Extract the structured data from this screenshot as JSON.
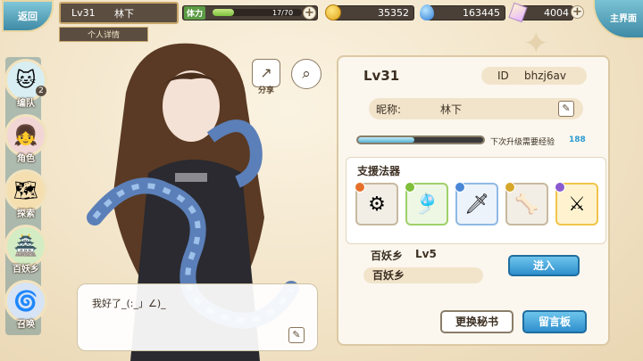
{
  "topbar": {
    "back_label": "返回",
    "level": "Lv31",
    "player_name": "林下",
    "tab_label": "个人详情",
    "stamina_label": "体力",
    "stamina_value": "17/70",
    "stamina_fraction": 0.243,
    "gold": "35352",
    "spirit": "163445",
    "crystal": "4004",
    "home_label": "主界面"
  },
  "nav": {
    "items": [
      {
        "label": "编队",
        "badge": "2",
        "icon": "cat-team-icon"
      },
      {
        "label": "角色",
        "icon": "character-icon"
      },
      {
        "label": "探索",
        "icon": "explore-icon"
      },
      {
        "label": "百妖乡",
        "icon": "village-icon"
      },
      {
        "label": "召唤",
        "icon": "summon-icon"
      }
    ]
  },
  "actions": {
    "share_label": "分享"
  },
  "speech": {
    "text": "我好了_(:_」∠)_"
  },
  "profile": {
    "level": "Lv31",
    "id_label": "ID",
    "id_value": "bhzj6av",
    "nickname_label": "昵称:",
    "nickname_value": "林下",
    "exp_fraction": 0.45,
    "exp_label": "下次升级需要经验",
    "exp_value": "188"
  },
  "support": {
    "title": "支援法器",
    "items": [
      {
        "icon": "spiked-bracelet-icon",
        "border": "#c7b9a0",
        "corner": "#e6702a",
        "bg": "#f2eee6"
      },
      {
        "icon": "green-scarf-icon",
        "border": "#9fd06a",
        "corner": "#7fbf3a",
        "bg": "#eef7e4"
      },
      {
        "icon": "blade-icon",
        "border": "#8fb9e4",
        "corner": "#4a86d6",
        "bg": "#edf3fb"
      },
      {
        "icon": "bone-bundle-icon",
        "border": "#c7b9a0",
        "corner": "#d6a72a",
        "bg": "#f2eee6"
      },
      {
        "icon": "spirit-sword-icon",
        "border": "#f1c54a",
        "corner": "#8a5ad0",
        "bg": "#fff3cf"
      }
    ]
  },
  "village": {
    "name": "百妖乡",
    "level": "Lv5",
    "pill": "百妖乡",
    "enter_label": "进入"
  },
  "buttons": {
    "change_secretary": "更换秘书",
    "message_board": "留言板"
  }
}
